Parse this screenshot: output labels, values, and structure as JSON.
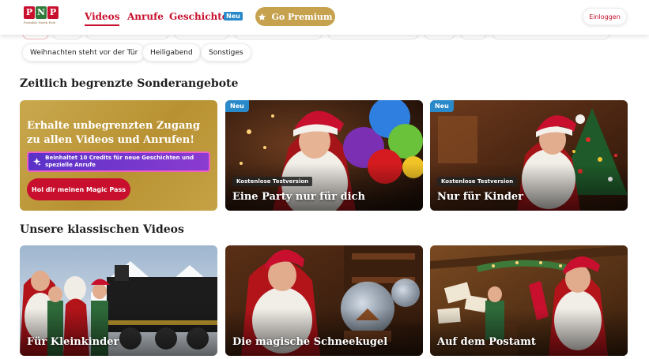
{
  "header": {
    "logo": {
      "letters": [
        "P",
        "N",
        "P"
      ],
      "tagline": "Portable North Pole"
    },
    "nav": [
      {
        "label": "Videos",
        "active": true
      },
      {
        "label": "Anrufe",
        "active": false
      },
      {
        "label": "Geschichten",
        "active": false
      }
    ],
    "stories_badge": "Neu",
    "premium_label": "Go Premium",
    "login_label": "Einloggen"
  },
  "filter_chips": [
    "Weihnachten steht vor der Tür",
    "Heiligabend",
    "Sonstiges"
  ],
  "offers": {
    "title": "Zeitlich begrenzte Sonderangebote",
    "promo": {
      "headline": "Erhalte unbegrenzten Zugang zu allen Videos und Anrufen!",
      "credits_text": "Beinhaltet 10 Credits für neue Geschichten und spezielle Anrufe",
      "cta_label": "Hol dir meinen Magic Pass"
    },
    "cards": [
      {
        "badge": "Neu",
        "trial": "Kostenlose Testversion",
        "title": "Eine Party nur für dich"
      },
      {
        "badge": "Neu",
        "trial": "Kostenlose Testversion",
        "title": "Nur für Kinder"
      }
    ]
  },
  "classics": {
    "title": "Unsere klassischen Videos",
    "cards": [
      {
        "title": "Für Kleinkinder"
      },
      {
        "title": "Die magische Schneekugel"
      },
      {
        "title": "Auf dem Postamt"
      }
    ]
  },
  "colors": {
    "brand_red": "#c8102e",
    "premium_gold": "#c6a24f",
    "badge_blue": "#2a89c9",
    "promo_purple": "#5a32c8",
    "promo_pink_border": "#f05fc4"
  },
  "icons": {
    "premium": "star-icon",
    "credits": "sparkle-icon"
  }
}
